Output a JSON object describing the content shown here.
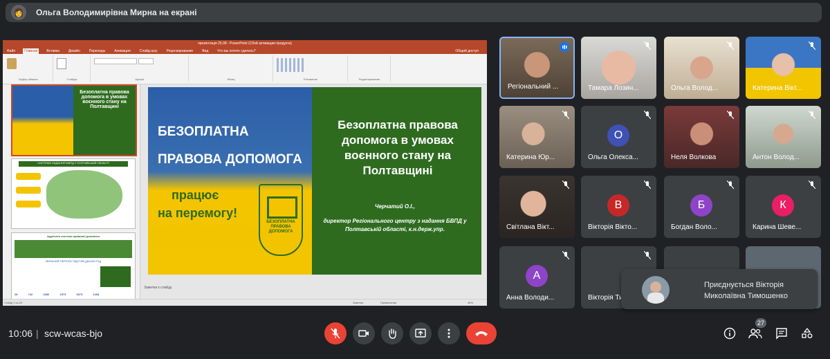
{
  "header": {
    "title": "Ольга Володимирівна Мирна на екрані"
  },
  "ppt": {
    "window_title": "презентація 25.08 - PowerPoint (Сбой активации продукта)",
    "tabs": [
      "Файл",
      "Главная",
      "Вставка",
      "Дизайн",
      "Переходы",
      "Анимация",
      "Слайд-шоу",
      "Рецензирование",
      "Вид",
      "Что вы хотите сделать?"
    ],
    "active_tab": "Главная",
    "groups": [
      "Буфер обмена",
      "Слайды",
      "Шрифт",
      "Абзац",
      "Рисование",
      "Редактирование"
    ],
    "share_label": "Общий доступ",
    "thumb1_title": "Безоплатна правова допомога в умовах воєнного стану на Полтавщині",
    "thumb2_title": "СИСТЕМА НАДАННЯ БВПД У ПОЛТАВСЬКІЙ ОБЛАСТІ",
    "thumb3_title": "Адресати системи правової допомоги",
    "thumb3_sub": "ЗВІЛЬНИЙ ПЕРЕЛІК ПІДСТАВ (ДАНИХ РЦ)",
    "thumb3_stats": [
      "28 742",
      "3282",
      "1573",
      "3573",
      "1268"
    ],
    "notes": "Заметки к слайду",
    "status_left": "Слайд 1 из 29",
    "status_notes": "Заметки",
    "status_comments": "Примечания",
    "zoom": "46%"
  },
  "slide": {
    "left_line1": "БЕЗОПЛАТНА",
    "left_line2": "ПРАВОВА ДОПОМОГА",
    "left_line3": "працює",
    "left_line4": "на перемогу!",
    "logo_l1": "БЕЗОПЛАТНА",
    "logo_l2": "ПРАВОВА",
    "logo_l3": "ДОПОМОГА",
    "title": "Безоплатна правова допомога в умовах воєнного стану на Полтавщині",
    "author": "Черчатий О.І.,",
    "author_desc": "директор Регіонального центру з надання БВПД у Полтавській області, к.н.держ.упр."
  },
  "participants": [
    {
      "name": "Регіональний ...",
      "avatar": "",
      "color": ""
    },
    {
      "name": "Тамара Лозин...",
      "avatar": "",
      "color": ""
    },
    {
      "name": "Ольга Волод...",
      "avatar": "",
      "color": ""
    },
    {
      "name": "Катерина Вікт...",
      "avatar": "",
      "color": ""
    },
    {
      "name": "Катерина Юр...",
      "avatar": "",
      "color": ""
    },
    {
      "name": "Ольга Олекса...",
      "avatar": "О",
      "color": "#3f51b5"
    },
    {
      "name": "Неля Волкова",
      "avatar": "",
      "color": ""
    },
    {
      "name": "Антон Волод...",
      "avatar": "",
      "color": ""
    },
    {
      "name": "Світлана Вікт...",
      "avatar": "",
      "color": ""
    },
    {
      "name": "Вікторія Вікто...",
      "avatar": "В",
      "color": "#c62828"
    },
    {
      "name": "Богдан Воло...",
      "avatar": "Б",
      "color": "#8e44c8"
    },
    {
      "name": "Карина Шеве...",
      "avatar": "К",
      "color": "#e91e63"
    },
    {
      "name": "Анна Володи...",
      "avatar": "А",
      "color": "#8e44c8"
    },
    {
      "name": "Вікторія Ти...",
      "avatar": "",
      "color": ""
    }
  ],
  "toast": {
    "text": "Приєднується Вікторія Миколаївна Тимошенко"
  },
  "meeting": {
    "time": "10:06",
    "code": "scw-wcas-bjo",
    "participant_count": "27"
  }
}
